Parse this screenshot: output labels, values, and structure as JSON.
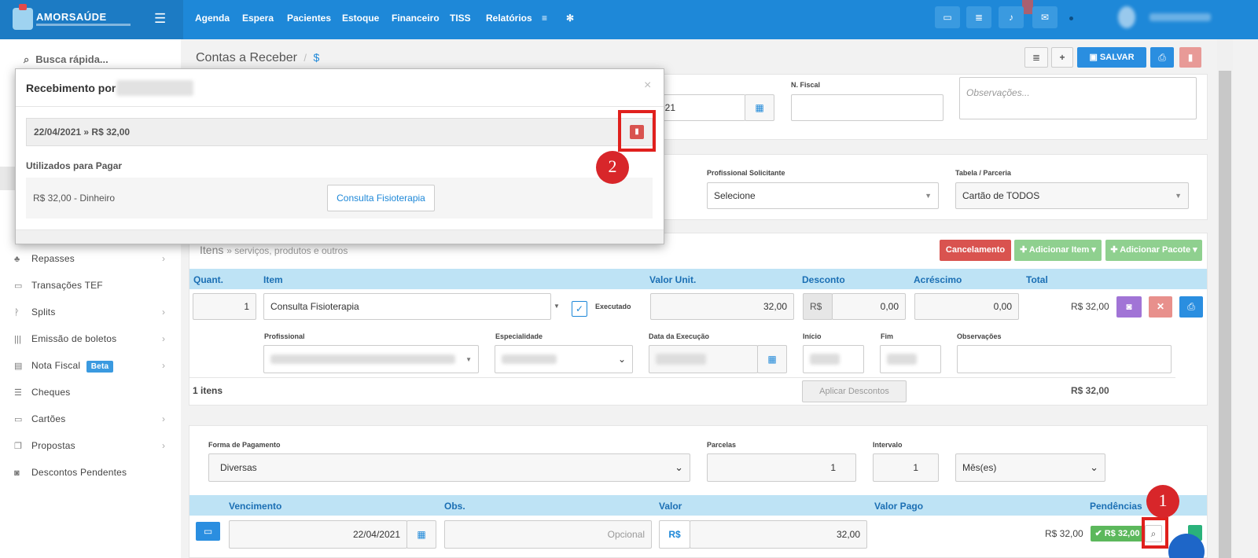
{
  "app": {
    "brand": "AMORSAÚDE"
  },
  "nav": {
    "items": [
      "Agenda",
      "Espera",
      "Pacientes",
      "Estoque",
      "Financeiro",
      "TISS",
      "Relatórios"
    ]
  },
  "sidebar": {
    "search": "Busca rápida...",
    "items": [
      {
        "label": "Repasses",
        "icon": "sitemap-icon",
        "chevron": true
      },
      {
        "label": "Transações TEF",
        "icon": "card-icon",
        "chevron": false
      },
      {
        "label": "Splits",
        "icon": "split-icon",
        "chevron": true
      },
      {
        "label": "Emissão de boletos",
        "icon": "barcode-icon",
        "chevron": true
      },
      {
        "label": "Nota Fiscal",
        "icon": "file-icon",
        "chevron": true,
        "badge": "Beta"
      },
      {
        "label": "Cheques",
        "icon": "list-icon",
        "chevron": false
      },
      {
        "label": "Cartões",
        "icon": "card-icon",
        "chevron": true
      },
      {
        "label": "Propostas",
        "icon": "copy-icon",
        "chevron": true
      },
      {
        "label": "Descontos Pendentes",
        "icon": "money-icon",
        "chevron": false
      }
    ]
  },
  "header": {
    "title": "Contas a Receber",
    "separator": "/",
    "currency_icon": "$",
    "save": "SALVAR"
  },
  "top_form": {
    "date_partial": "021",
    "nfiscal_label": "N. Fiscal",
    "obs_placeholder": "Observações...",
    "prof_sol_label": "Profissional Solicitante",
    "prof_sol_value": "Selecione",
    "tabela_label": "Tabela / Parceria",
    "tabela_value": "Cartão de TODOS"
  },
  "items": {
    "title": "Itens",
    "subtitle": "» serviços, produtos e outros",
    "btn_cancel": "Cancelamento",
    "btn_add_item": "✚ Adicionar Item ▾",
    "btn_add_pkg": "✚ Adicionar Pacote ▾",
    "headers": [
      "Quant.",
      "Item",
      "Valor Unit.",
      "Desconto",
      "Acréscimo",
      "Total"
    ],
    "row": {
      "qty": "1",
      "item": "Consulta Fisioterapia",
      "executado": "Executado",
      "unit": "32,00",
      "disc_prefix": "R$",
      "disc": "0,00",
      "acr": "0,00",
      "total": "R$ 32,00"
    },
    "sub_labels": {
      "prof": "Profissional",
      "esp": "Especialidade",
      "data": "Data da Execução",
      "inicio": "Início",
      "fim": "Fim",
      "obs": "Observações"
    },
    "footer": {
      "count": "1 itens",
      "apply": "Aplicar Descontos",
      "total": "R$ 32,00"
    }
  },
  "payment": {
    "forma_label": "Forma de Pagamento",
    "forma_value": "Diversas",
    "parcelas_label": "Parcelas",
    "parcelas_value": "1",
    "intervalo_label": "Intervalo",
    "intervalo_value": "1",
    "periodo": "Mês(es)",
    "headers": [
      "Vencimento",
      "Obs.",
      "Valor",
      "Valor Pago",
      "Pendências"
    ],
    "row": {
      "venc": "22/04/2021",
      "obs": "Opcional",
      "cur": "R$",
      "valor": "32,00",
      "pago": "R$ 32,00",
      "badge": "✔ R$ 32,00"
    }
  },
  "modal": {
    "title": "Recebimento por",
    "close": "×",
    "entry": "22/04/2021 » R$ 32,00",
    "utilizados": "Utilizados para Pagar",
    "pay_line": "R$ 32,00 - Dinheiro",
    "consulta_btn": "Consulta Fisioterapia"
  },
  "markers": {
    "one": "1",
    "two": "2"
  },
  "colors": {
    "primary": "#1e88d8",
    "danger": "#d9534f",
    "success": "#5cb85c",
    "purple": "#a174d6",
    "marker": "#d8262a"
  }
}
